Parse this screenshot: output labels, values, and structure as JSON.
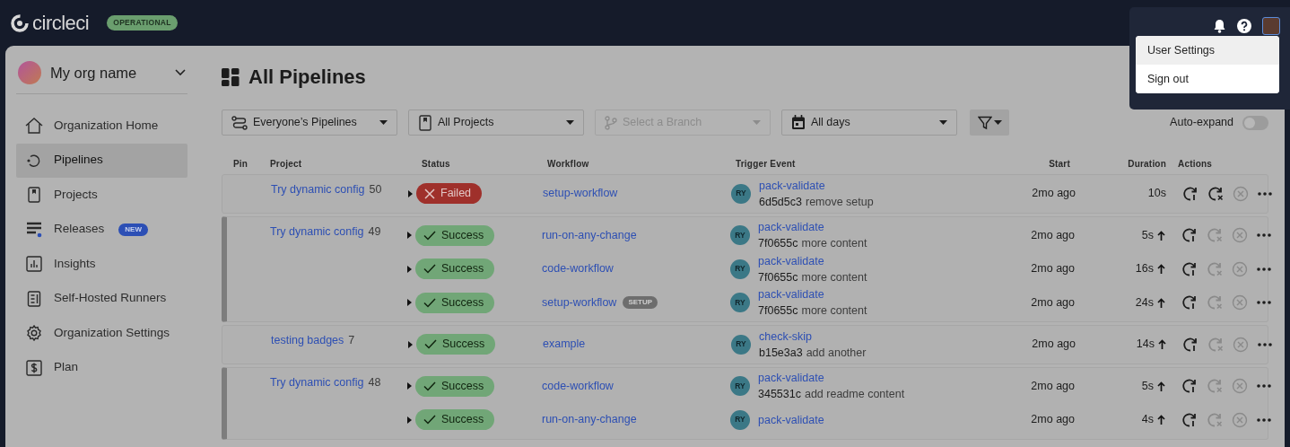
{
  "topbar": {
    "logo": "circleci",
    "status_badge": "OPERATIONAL"
  },
  "user_menu": {
    "items": [
      {
        "label": "User Settings",
        "selected": true
      },
      {
        "label": "Sign out",
        "selected": false
      }
    ]
  },
  "sidebar": {
    "org_name": "My org name",
    "items": [
      {
        "label": "Organization Home",
        "selected": false
      },
      {
        "label": "Pipelines",
        "selected": true
      },
      {
        "label": "Projects",
        "selected": false
      },
      {
        "label": "Releases",
        "selected": false,
        "badge": "NEW"
      },
      {
        "label": "Insights",
        "selected": false
      },
      {
        "label": "Self-Hosted Runners",
        "selected": false
      },
      {
        "label": "Organization Settings",
        "selected": false
      },
      {
        "label": "Plan",
        "selected": false
      }
    ]
  },
  "page_title": "All Pipelines",
  "filters": [
    {
      "value": "Everyone’s Pipelines",
      "disabled": false
    },
    {
      "value": "All Projects",
      "disabled": false
    },
    {
      "placeholder": "Select a Branch",
      "disabled": true
    },
    {
      "value": "All days",
      "disabled": false
    }
  ],
  "auto_expand": {
    "label": "Auto-expand",
    "on": false
  },
  "table": {
    "columns": [
      "Pin",
      "Project",
      "Status",
      "Workflow",
      "Trigger Event",
      "Start",
      "Duration",
      "Actions"
    ],
    "pipelines": [
      {
        "project": "Try dynamic config",
        "number": "50",
        "workflows": [
          {
            "kind": "failed",
            "status_label": "Failed",
            "name": "setup-workflow",
            "actor": "RY",
            "branch": "pack-validate",
            "commit": "6d5d5c3",
            "message": "remove setup",
            "start": "2mo ago",
            "duration": "10s",
            "duration_up": false,
            "rerun_failed_enabled": true
          }
        ]
      },
      {
        "project": "Try dynamic config",
        "number": "49",
        "workflows": [
          {
            "kind": "success",
            "status_label": "Success",
            "name": "run-on-any-change",
            "actor": "RY",
            "branch": "pack-validate",
            "commit": "7f0655c",
            "message": "more content",
            "start": "2mo ago",
            "duration": "5s",
            "duration_up": true,
            "rerun_failed_enabled": false
          },
          {
            "kind": "success",
            "status_label": "Success",
            "name": "code-workflow",
            "actor": "RY",
            "branch": "pack-validate",
            "commit": "7f0655c",
            "message": "more content",
            "start": "2mo ago",
            "duration": "16s",
            "duration_up": true,
            "rerun_failed_enabled": false
          },
          {
            "kind": "success",
            "status_label": "Success",
            "name": "setup-workflow",
            "tag": "SETUP",
            "actor": "RY",
            "branch": "pack-validate",
            "commit": "7f0655c",
            "message": "more content",
            "start": "2mo ago",
            "duration": "24s",
            "duration_up": true,
            "rerun_failed_enabled": false
          }
        ]
      },
      {
        "project": "testing badges",
        "number": "7",
        "workflows": [
          {
            "kind": "success",
            "status_label": "Success",
            "name": "example",
            "actor": "RY",
            "branch": "check-skip",
            "commit": "b15e3a3",
            "message": "add another",
            "start": "2mo ago",
            "duration": "14s",
            "duration_up": true,
            "rerun_failed_enabled": false
          }
        ]
      },
      {
        "project": "Try dynamic config",
        "number": "48",
        "workflows": [
          {
            "kind": "success",
            "status_label": "Success",
            "name": "code-workflow",
            "actor": "RY",
            "branch": "pack-validate",
            "commit": "345531c",
            "message": "add readme content",
            "start": "2mo ago",
            "duration": "5s",
            "duration_up": true,
            "rerun_failed_enabled": false
          },
          {
            "kind": "success",
            "status_label": "Success",
            "name": "run-on-any-change",
            "actor": "RY",
            "branch": "pack-validate",
            "start": "2mo ago",
            "duration": "4s",
            "duration_up": true,
            "rerun_failed_enabled": false
          }
        ]
      }
    ]
  }
}
